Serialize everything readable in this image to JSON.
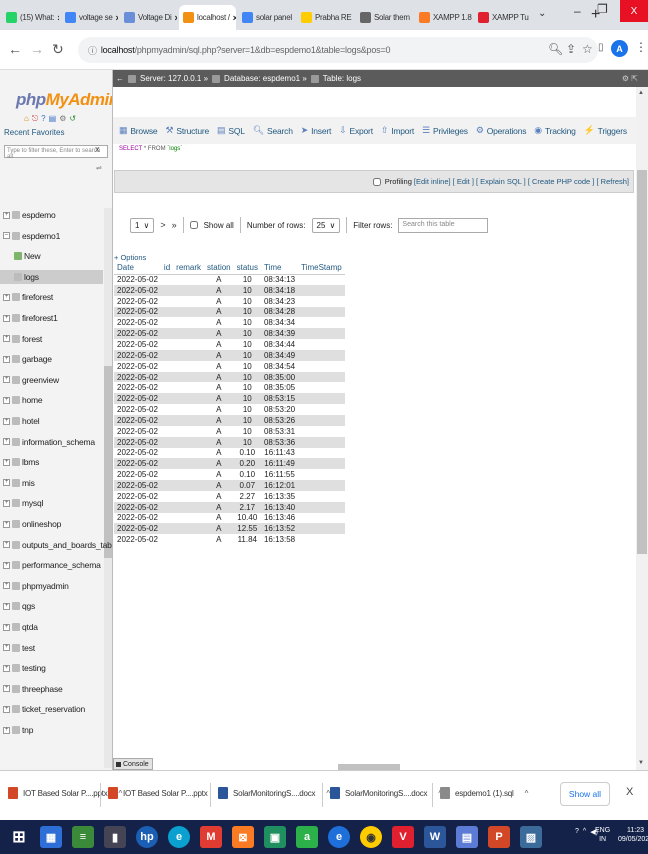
{
  "browser": {
    "tabs": [
      {
        "label": "(15) What:",
        "icon": "whatsapp-icon",
        "color": "#25d366"
      },
      {
        "label": "voltage se",
        "icon": "google-icon",
        "color": "#4285f4"
      },
      {
        "label": "Voltage Di",
        "icon": "site-icon",
        "color": "#6a8fd8"
      },
      {
        "label": "localhost /",
        "icon": "phpmyadmin-icon",
        "color": "#f29111"
      },
      {
        "label": "solar panel",
        "icon": "google-icon",
        "color": "#4285f4"
      },
      {
        "label": "Prabha RE",
        "icon": "site-icon",
        "color": "#ffcc00"
      },
      {
        "label": "Solar them",
        "icon": "wikipedia-icon",
        "color": "#666666"
      },
      {
        "label": "XAMPP 1.8",
        "icon": "xampp-icon",
        "color": "#fb7a24"
      },
      {
        "label": "XAMPP Tu",
        "icon": "xampp-icon",
        "color": "#e0202f"
      }
    ],
    "new_tab": "+",
    "url_host": "localhost",
    "url_path": "/phpmyadmin/sql.php?server=1&db=espdemo1&table=logs&pos=0",
    "profile_initial": "A",
    "window_controls": {
      "minimize": "–",
      "maximize": "❐",
      "close": "X"
    }
  },
  "sidebar": {
    "logo_php": "php",
    "logo_my": "MyAdmin",
    "recent_favorites": "Recent   Favorites",
    "filter_placeholder": "Type to filter these, Enter to search all",
    "filter_clear": "X",
    "tree": [
      {
        "label": "espdemo",
        "expander": "+"
      },
      {
        "label": "espdemo1",
        "expander": "–"
      },
      {
        "label": "New",
        "child": true
      },
      {
        "label": "logs",
        "child": true,
        "selected": true
      },
      {
        "label": "fireforest",
        "expander": "+"
      },
      {
        "label": "fireforest1",
        "expander": "+"
      },
      {
        "label": "forest",
        "expander": "+"
      },
      {
        "label": "garbage",
        "expander": "+"
      },
      {
        "label": "greenview",
        "expander": "+"
      },
      {
        "label": "home",
        "expander": "+"
      },
      {
        "label": "hotel",
        "expander": "+"
      },
      {
        "label": "information_schema",
        "expander": "+"
      },
      {
        "label": "lbms",
        "expander": "+"
      },
      {
        "label": "mis",
        "expander": "+"
      },
      {
        "label": "mysql",
        "expander": "+"
      },
      {
        "label": "onlineshop",
        "expander": "+"
      },
      {
        "label": "outputs_and_boards_table",
        "expander": "+"
      },
      {
        "label": "performance_schema",
        "expander": "+"
      },
      {
        "label": "phpmyadmin",
        "expander": "+"
      },
      {
        "label": "qgs",
        "expander": "+"
      },
      {
        "label": "qtda",
        "expander": "+"
      },
      {
        "label": "test",
        "expander": "+"
      },
      {
        "label": "testing",
        "expander": "+"
      },
      {
        "label": "threephase",
        "expander": "+"
      },
      {
        "label": "ticket_reservation",
        "expander": "+"
      },
      {
        "label": "tnp",
        "expander": "+"
      }
    ]
  },
  "breadcrumb": {
    "server": "Server: 127.0.0.1 »",
    "database": "Database: espdemo1 »",
    "table": "Table: logs"
  },
  "menu": [
    "Browse",
    "Structure",
    "SQL",
    "Search",
    "Insert",
    "Export",
    "Import",
    "Privileges",
    "Operations",
    "Tracking",
    "Triggers"
  ],
  "sql_snippet": {
    "select": "SELECT",
    "star": "* FROM",
    "table": "`logs`"
  },
  "profiling": {
    "label": "Profiling",
    "links": "[Edit inline] [ Edit ] [ Explain SQL ] [ Create PHP code ] [ Refresh]"
  },
  "navigation": {
    "page": "1",
    "next": ">",
    "last": "»",
    "show_all": "Show all",
    "rows_label": "Number of rows:",
    "rows_value": "25",
    "filter_label": "Filter rows:",
    "filter_placeholder": "Search this table"
  },
  "options_link": "+ Options",
  "table": {
    "columns": [
      "Date",
      "id",
      "remark",
      "station",
      "status",
      "Time",
      "TimeStamp"
    ],
    "rows": [
      [
        "2022-05-02",
        "",
        "",
        "A",
        "10",
        "08:34:13",
        ""
      ],
      [
        "2022-05-02",
        "",
        "",
        "A",
        "10",
        "08:34:18",
        ""
      ],
      [
        "2022-05-02",
        "",
        "",
        "A",
        "10",
        "08:34:23",
        ""
      ],
      [
        "2022-05-02",
        "",
        "",
        "A",
        "10",
        "08:34:28",
        ""
      ],
      [
        "2022-05-02",
        "",
        "",
        "A",
        "10",
        "08:34:34",
        ""
      ],
      [
        "2022-05-02",
        "",
        "",
        "A",
        "10",
        "08:34:39",
        ""
      ],
      [
        "2022-05-02",
        "",
        "",
        "A",
        "10",
        "08:34:44",
        ""
      ],
      [
        "2022-05-02",
        "",
        "",
        "A",
        "10",
        "08:34:49",
        ""
      ],
      [
        "2022-05-02",
        "",
        "",
        "A",
        "10",
        "08:34:54",
        ""
      ],
      [
        "2022-05-02",
        "",
        "",
        "A",
        "10",
        "08:35:00",
        ""
      ],
      [
        "2022-05-02",
        "",
        "",
        "A",
        "10",
        "08:35:05",
        ""
      ],
      [
        "2022-05-02",
        "",
        "",
        "A",
        "10",
        "08:53:15",
        ""
      ],
      [
        "2022-05-02",
        "",
        "",
        "A",
        "10",
        "08:53:20",
        ""
      ],
      [
        "2022-05-02",
        "",
        "",
        "A",
        "10",
        "08:53:26",
        ""
      ],
      [
        "2022-05-02",
        "",
        "",
        "A",
        "10",
        "08:53:31",
        ""
      ],
      [
        "2022-05-02",
        "",
        "",
        "A",
        "10",
        "08:53:36",
        ""
      ],
      [
        "2022-05-02",
        "",
        "",
        "A",
        "0.10",
        "16:11:43",
        ""
      ],
      [
        "2022-05-02",
        "",
        "",
        "A",
        "0.20",
        "16:11:49",
        ""
      ],
      [
        "2022-05-02",
        "",
        "",
        "A",
        "0.10",
        "16:11:55",
        ""
      ],
      [
        "2022-05-02",
        "",
        "",
        "A",
        "0.07",
        "16:12:01",
        ""
      ],
      [
        "2022-05-02",
        "",
        "",
        "A",
        "2.27",
        "16:13:35",
        ""
      ],
      [
        "2022-05-02",
        "",
        "",
        "A",
        "2.17",
        "16:13:40",
        ""
      ],
      [
        "2022-05-02",
        "",
        "",
        "A",
        "10.40",
        "16:13:46",
        ""
      ],
      [
        "2022-05-02",
        "",
        "",
        "A",
        "12.55",
        "16:13:52",
        ""
      ],
      [
        "2022-05-02",
        "",
        "",
        "A",
        "11.84",
        "16:13:58",
        ""
      ]
    ]
  },
  "console_label": "Console",
  "downloads": {
    "items": [
      {
        "name": "IOT Based Solar P....pptx",
        "icon": "powerpoint-icon",
        "color": "#d24726"
      },
      {
        "name": "IOT Based Solar P....pptx",
        "icon": "powerpoint-icon",
        "color": "#d24726"
      },
      {
        "name": "SolarMonitoringS....docx",
        "icon": "word-icon",
        "color": "#2b579a"
      },
      {
        "name": "SolarMonitoringS....docx",
        "icon": "word-icon",
        "color": "#2b579a"
      },
      {
        "name": "espdemo1 (1).sql",
        "icon": "file-icon",
        "color": "#8a8a8a"
      }
    ],
    "caret": "^",
    "show_all": "Show all",
    "close": "X"
  },
  "taskbar": {
    "lang_top": "ENG",
    "lang_bottom": "IN",
    "time": "11:23",
    "date": "09/05/2022"
  }
}
